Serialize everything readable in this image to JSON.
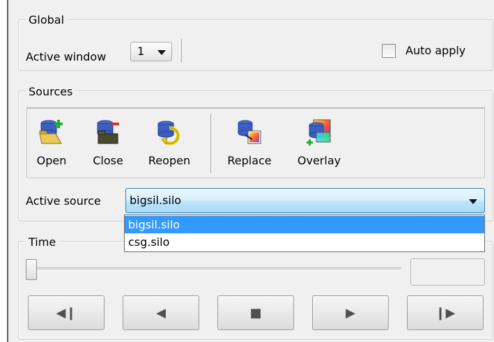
{
  "global": {
    "title": "Global",
    "active_window_label": "Active window",
    "active_window_value": "1",
    "auto_apply_label": "Auto apply",
    "auto_apply_checked": false
  },
  "sources": {
    "title": "Sources",
    "toolbar": [
      {
        "label": "Open",
        "icon": "open-database-icon"
      },
      {
        "label": "Close",
        "icon": "close-database-icon"
      },
      {
        "label": "Reopen",
        "icon": "reopen-database-icon"
      },
      {
        "label": "Replace",
        "icon": "replace-database-icon"
      },
      {
        "label": "Overlay",
        "icon": "overlay-database-icon"
      }
    ],
    "active_source_label": "Active source",
    "active_source_value": "bigsil.silo",
    "options": [
      "bigsil.silo",
      "csg.silo"
    ]
  },
  "time": {
    "title": "Time",
    "slider_position": 0,
    "time_value": "",
    "buttons": [
      {
        "name": "step-back",
        "glyph": "◀❙"
      },
      {
        "name": "play-reverse",
        "glyph": "◀"
      },
      {
        "name": "stop",
        "glyph": "■"
      },
      {
        "name": "play",
        "glyph": "▶"
      },
      {
        "name": "step-forward",
        "glyph": "❙▶"
      }
    ]
  },
  "colors": {
    "selection": "#3399ff",
    "combo_border": "#3c7fb1",
    "background": "#f0f0f0"
  }
}
